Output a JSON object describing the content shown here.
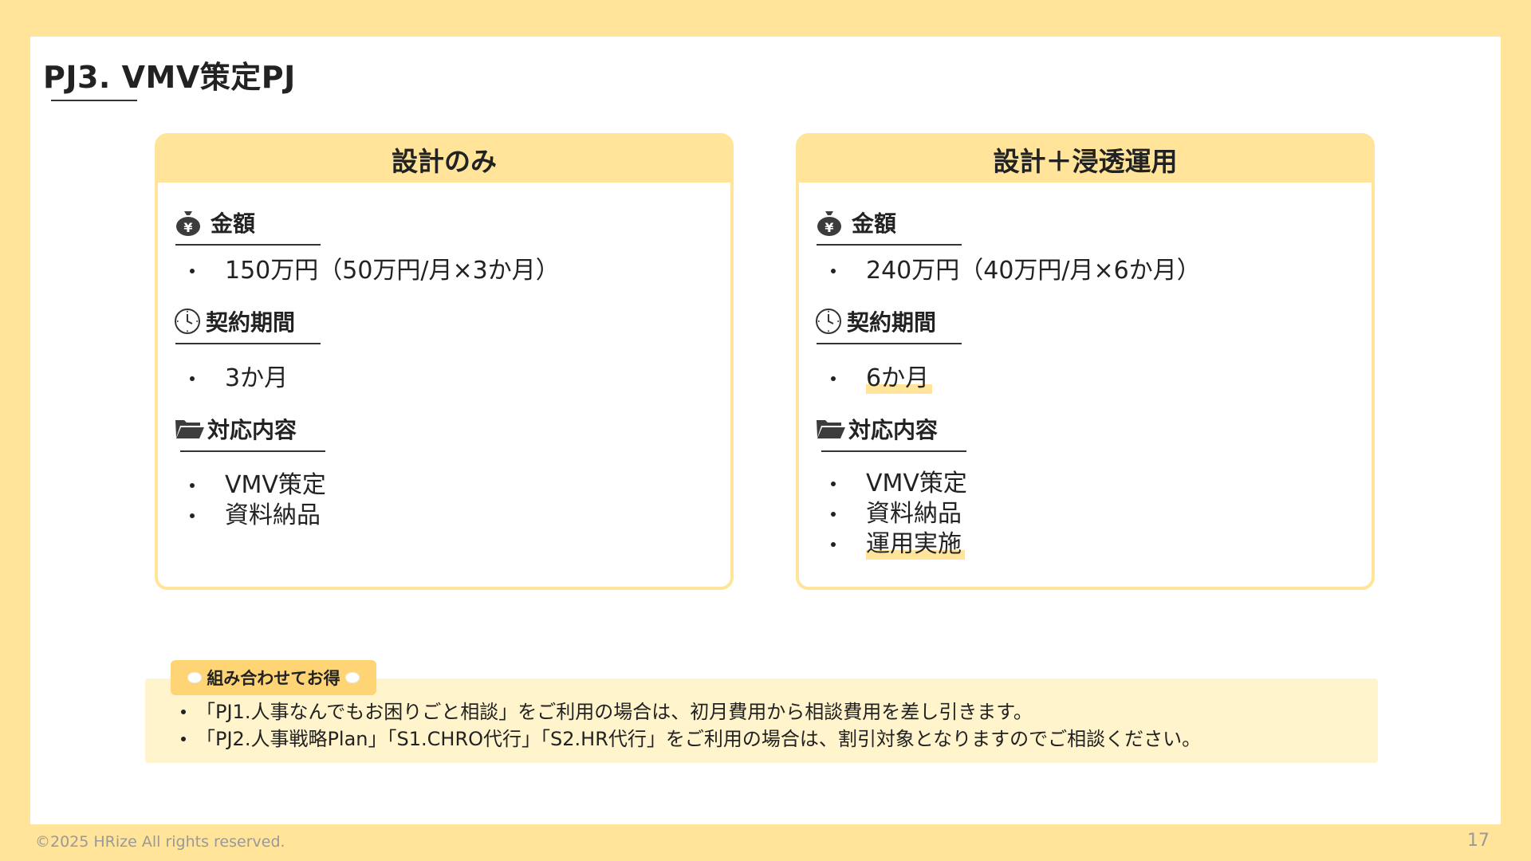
{
  "slide": {
    "title": "PJ3. VMV策定PJ",
    "footer_copyright": "©2025 HRize All rights reserved.",
    "page_number": "17"
  },
  "plans": [
    {
      "title": "設計のみ",
      "price_heading": "金額",
      "price_items": [
        "150万円（50万円/月×3か月）"
      ],
      "period_heading": "契約期間",
      "period_items": [
        "3か月"
      ],
      "scope_heading": "対応内容",
      "scope_items": [
        "VMV策定",
        "資料納品"
      ]
    },
    {
      "title": "設計＋浸透運用",
      "price_heading": "金額",
      "price_items": [
        "240万円（40万円/月×6か月）"
      ],
      "period_heading": "契約期間",
      "period_items": [
        "6か月"
      ],
      "scope_heading": "対応内容",
      "scope_items": [
        "VMV策定",
        "資料納品",
        "運用実施"
      ]
    }
  ],
  "combo": {
    "badge": "組み合わせてお得",
    "lines": [
      "「PJ1.人事なんでもお困りごと相談」をご利用の場合は、初月費用から相談費用を差し引きます。",
      "「PJ2.人事戦略Plan」「S1.CHRO代行」「S2.HR代行」をご利用の場合は、割引対象となりますのでご相談ください。"
    ]
  },
  "icons": {
    "price": "money-bag-icon",
    "period": "clock-icon",
    "scope": "open-folder-icon"
  },
  "colors": {
    "frame": "#FFE499",
    "card_border": "#FFE499",
    "tip_background": "#FFF4CC",
    "tip_badge": "#FFD474",
    "highlight": "#FFE499"
  }
}
